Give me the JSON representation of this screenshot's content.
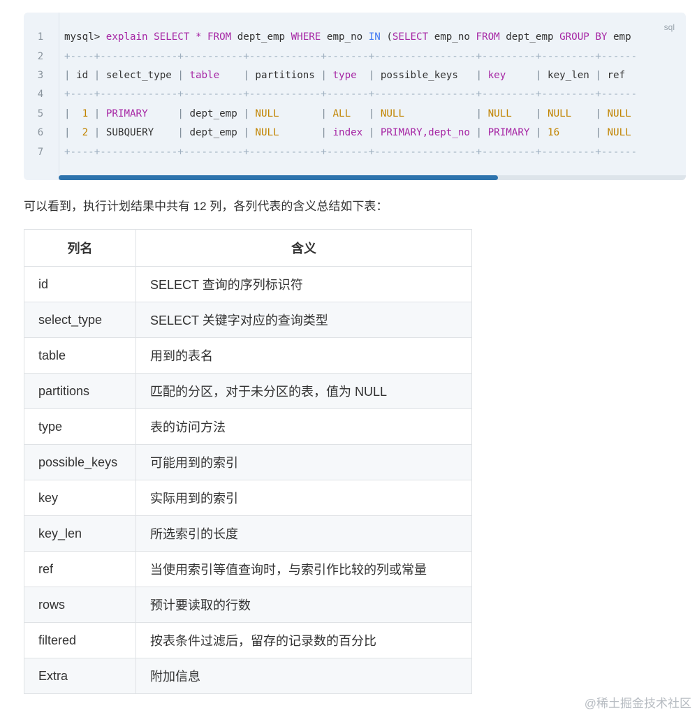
{
  "code": {
    "language": "sql",
    "line_numbers": [
      "1",
      "2",
      "3",
      "4",
      "5",
      "6",
      "7"
    ],
    "line1": {
      "prompt": "mysql>",
      "t1": "explain",
      "t2": "SELECT",
      "t3": "*",
      "t4": "FROM",
      "t5": "dept_emp",
      "t6": "WHERE",
      "t7": "emp_no",
      "t8": "IN",
      "t9": "(",
      "t10": "SELECT",
      "t11": "emp_no",
      "t12": "FROM",
      "t13": "dept_emp",
      "t14": "GROUP",
      "t15": "BY",
      "t16": "emp"
    },
    "divider": "+----+-------------+----------+------------+-------+-----------------+---------+---------+------",
    "header": [
      "id",
      "select_type",
      "table",
      "partitions",
      "type",
      "possible_keys",
      "key",
      "key_len",
      "ref"
    ],
    "rows": [
      [
        "1",
        "PRIMARY",
        "dept_emp",
        "NULL",
        "ALL",
        "NULL",
        "NULL",
        "NULL",
        "NULL"
      ],
      [
        "2",
        "SUBQUERY",
        "dept_emp",
        "NULL",
        "index",
        "PRIMARY,dept_no",
        "PRIMARY",
        "16",
        "NULL"
      ]
    ],
    "scroll_fraction": 0.7
  },
  "intro": "可以看到，执行计划结果中共有 12 列，各列代表的含义总结如下表：",
  "table": {
    "headers": [
      "列名",
      "含义"
    ],
    "rows": [
      [
        "id",
        "SELECT 查询的序列标识符"
      ],
      [
        "select_type",
        "SELECT 关键字对应的查询类型"
      ],
      [
        "table",
        "用到的表名"
      ],
      [
        "partitions",
        "匹配的分区，对于未分区的表，值为 NULL"
      ],
      [
        "type",
        "表的访问方法"
      ],
      [
        "possible_keys",
        "可能用到的索引"
      ],
      [
        "key",
        "实际用到的索引"
      ],
      [
        "key_len",
        "所选索引的长度"
      ],
      [
        "ref",
        "当使用索引等值查询时，与索引作比较的列或常量"
      ],
      [
        "rows",
        "预计要读取的行数"
      ],
      [
        "filtered",
        "按表条件过滤后，留存的记录数的百分比"
      ],
      [
        "Extra",
        "附加信息"
      ]
    ]
  },
  "watermark": "@稀土掘金技术社区"
}
